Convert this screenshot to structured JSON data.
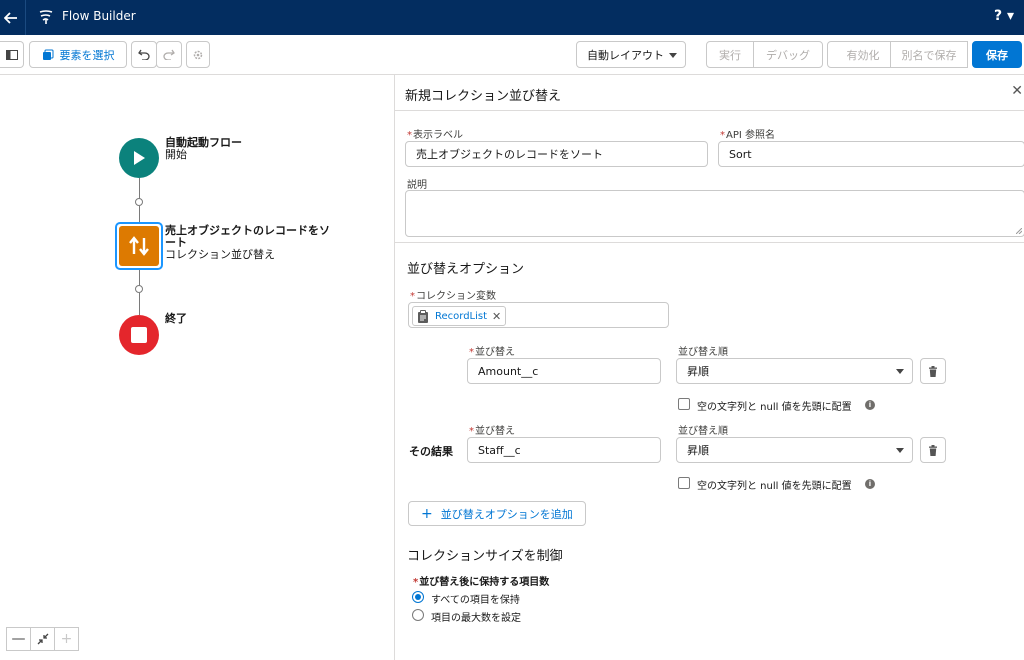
{
  "topbar": {
    "app_title": "Flow Builder",
    "help_label": "? ▾"
  },
  "toolbar": {
    "select_elements_label": "要素を選択",
    "auto_layout_label": "自動レイアウト",
    "run_label": "実行",
    "debug_label": "デバッグ",
    "activate_label": "有効化",
    "save_as_label": "別名で保存",
    "save_label": "保存"
  },
  "canvas": {
    "start_node": {
      "title": "自動起動フロー",
      "subtitle": "開始"
    },
    "sort_node": {
      "title": "売上オブジェクトのレコードをソート",
      "subtitle": "コレクション並び替え"
    },
    "end_node": {
      "title": "終了"
    },
    "colors": {
      "start": "#0b827c",
      "sort": "#dd7a01",
      "end": "#e4262c",
      "selected_outline": "#1b96ff"
    }
  },
  "panel": {
    "title": "新規コレクション並び替え",
    "close_icon": "close-icon",
    "label_field": {
      "label": "表示ラベル",
      "value": "売上オブジェクトのレコードをソート"
    },
    "api_field": {
      "label": "API 参照名",
      "value": "Sort"
    },
    "description_label": "説明",
    "sort_options": {
      "title": "並び替えオプション",
      "collection_label": "コレクション変数",
      "collection_value": "RecordList",
      "then_label": "その結果",
      "rows": [
        {
          "sort_label": "並び替え",
          "sort_value": "Amount__c",
          "order_label": "並び替え順",
          "order_value": "昇順",
          "null_first_label": "空の文字列と null 値を先頭に配置"
        },
        {
          "sort_label": "並び替え",
          "sort_value": "Staff__c",
          "order_label": "並び替え順",
          "order_value": "昇順",
          "null_first_label": "空の文字列と null 値を先頭に配置"
        }
      ],
      "add_option_label": "並び替えオプションを追加"
    },
    "collection_size": {
      "title": "コレクションサイズを制御",
      "keep_label": "並び替え後に保持する項目数",
      "options": [
        "すべての項目を保持",
        "項目の最大数を設定"
      ],
      "selected": "すべての項目を保持"
    }
  }
}
